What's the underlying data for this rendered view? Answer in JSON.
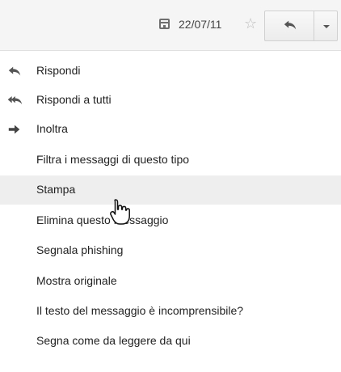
{
  "header": {
    "date": "22/07/11",
    "calendar_icon": "calendar-icon",
    "star_icon": "star-icon",
    "reply_icon": "reply-icon",
    "dropdown_icon": "chevron-down-icon"
  },
  "menu": {
    "items": [
      {
        "label": "Rispondi",
        "icon": "reply-icon"
      },
      {
        "label": "Rispondi a tutti",
        "icon": "reply-all-icon"
      },
      {
        "label": "Inoltra",
        "icon": "forward-icon"
      },
      {
        "label": "Filtra i messaggi di questo tipo"
      },
      {
        "label": "Stampa",
        "state": "hover"
      },
      {
        "label": "Elimina questo messaggio"
      },
      {
        "label": "Segnala phishing"
      },
      {
        "label": "Mostra originale"
      },
      {
        "label": "Il testo del messaggio è incomprensibile?"
      },
      {
        "label": "Segna come da leggere da qui"
      }
    ]
  },
  "colors": {
    "hover_bg": "#eeeeee",
    "toolbar_bg": "#f5f5f5",
    "text": "#222222"
  }
}
